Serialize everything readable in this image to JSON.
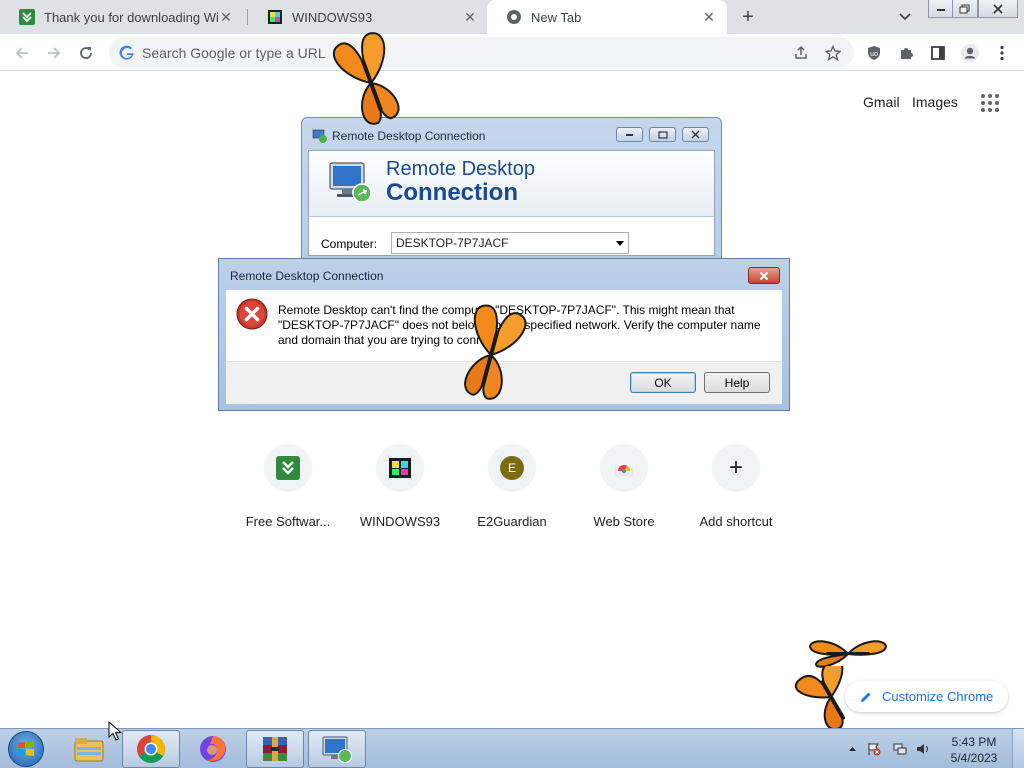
{
  "browser": {
    "tabs": [
      {
        "title": "Thank you for downloading WinRAR",
        "favicon": "download-favicon",
        "active": false
      },
      {
        "title": "WINDOWS93",
        "favicon": "windows93-favicon",
        "active": false
      },
      {
        "title": "New Tab",
        "favicon": "chrome-favicon",
        "active": true
      }
    ],
    "omnibox_placeholder": "Search Google or type a URL"
  },
  "newtab": {
    "links": {
      "gmail": "Gmail",
      "images": "Images"
    },
    "shortcuts": [
      {
        "label": "Free Softwar...",
        "icon": "download-icon"
      },
      {
        "label": "WINDOWS93",
        "icon": "windows93-icon"
      },
      {
        "label": "E2Guardian",
        "icon": "e2guardian-icon",
        "letter": "E"
      },
      {
        "label": "Web Store",
        "icon": "webstore-icon"
      },
      {
        "label": "Add shortcut",
        "icon": "plus-icon",
        "glyph": "+"
      }
    ],
    "customize_label": "Customize Chrome"
  },
  "rdc_window": {
    "title": "Remote Desktop Connection",
    "banner_line1": "Remote Desktop",
    "banner_line2": "Connection",
    "computer_label": "Computer:",
    "computer_value": "DESKTOP-7P7JACF"
  },
  "error_dialog": {
    "title": "Remote Desktop Connection",
    "message": "Remote Desktop can't find the computer \"DESKTOP-7P7JACF\". This might mean that \"DESKTOP-7P7JACF\" does not belong to the specified network.  Verify the computer name and domain that you are trying to connect to.",
    "ok_label": "OK",
    "help_label": "Help"
  },
  "taskbar": {
    "pinned": [
      "start-orb",
      "explorer-icon",
      "chrome-icon",
      "firefox-icon",
      "winrar-icon",
      "remote-desktop-icon"
    ],
    "clock_time": "5:43 PM",
    "clock_date": "5/4/2023"
  },
  "colors": {
    "accent": "#1a73e8",
    "rdc_heading": "#1a4a8f",
    "tab_strip": "#dee1e6",
    "taskbar": "#a4bcda",
    "error_red": "#c0392b"
  }
}
